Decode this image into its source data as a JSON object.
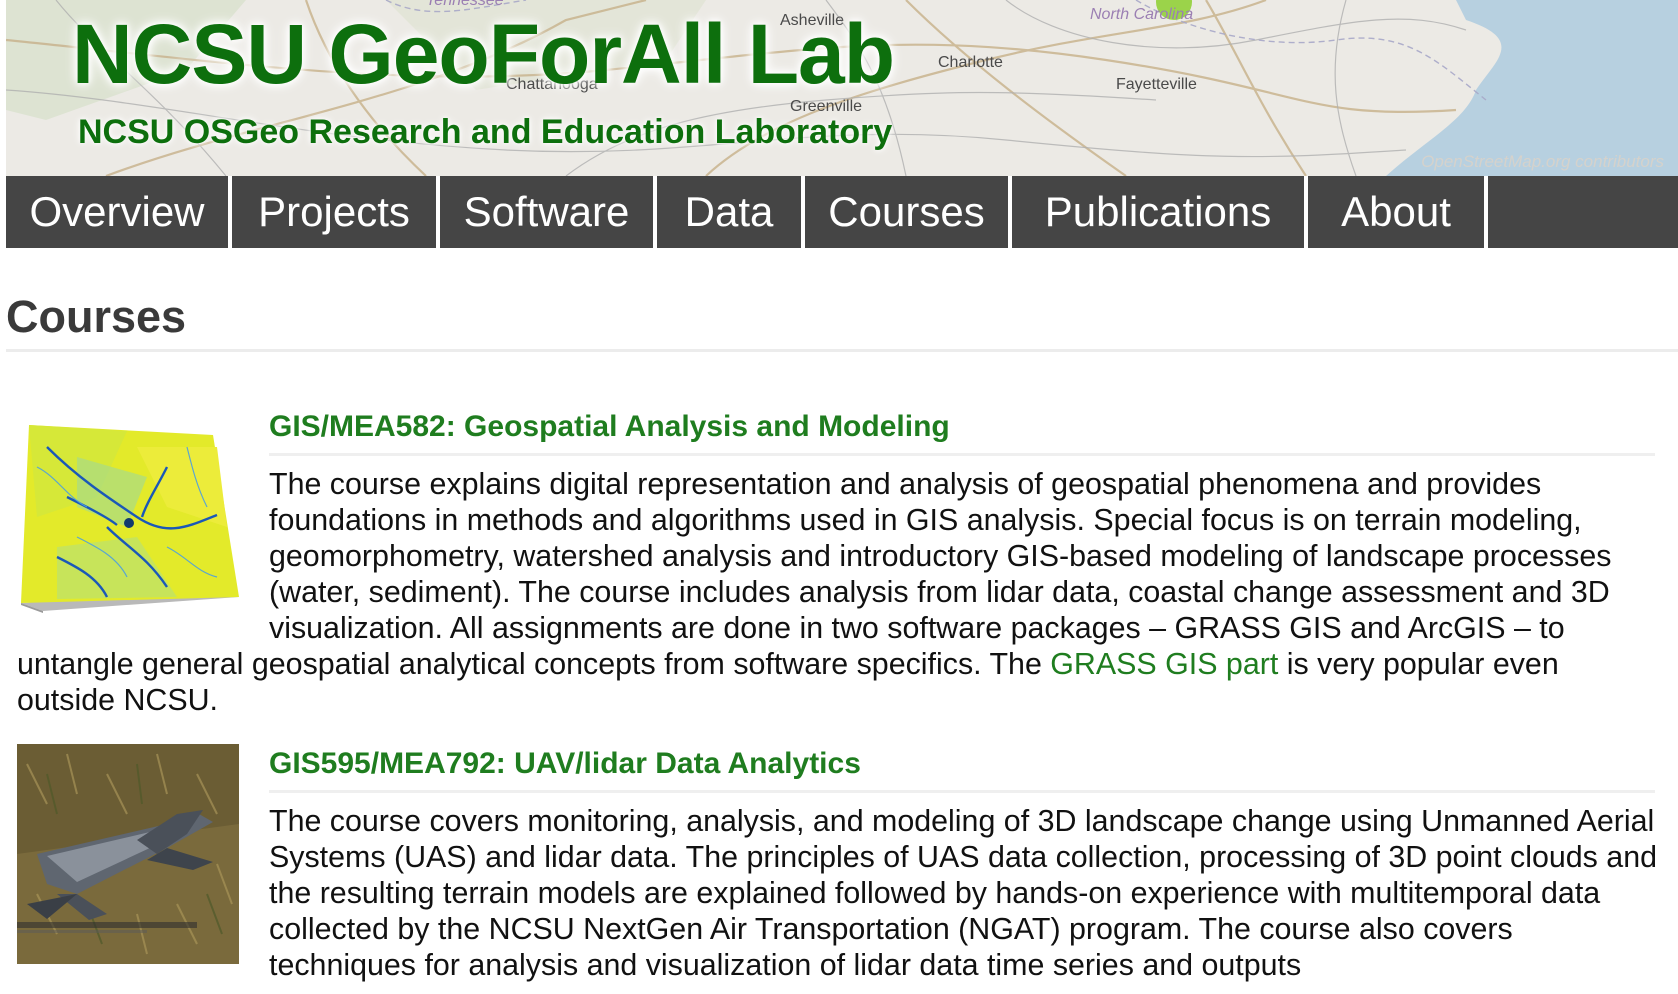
{
  "site": {
    "title": "NCSU GeoForAll Lab",
    "subtitle": "NCSU OSGeo Research and Education Laboratory",
    "map_labels": {
      "tennessee": "Tennessee",
      "asheville": "Asheville",
      "north_carolina": "North Carolina",
      "charlotte": "Charlotte",
      "fayetteville": "Fayetteville",
      "chattanooga": "Chattanooga",
      "greenville": "Greenville"
    },
    "map_credit": "OpenStreetMap.org contributors"
  },
  "nav": {
    "items": [
      {
        "label": "Overview"
      },
      {
        "label": "Projects"
      },
      {
        "label": "Software"
      },
      {
        "label": "Data"
      },
      {
        "label": "Courses"
      },
      {
        "label": "Publications"
      },
      {
        "label": "About"
      },
      {
        "label": ""
      }
    ]
  },
  "page": {
    "title": "Courses"
  },
  "courses": [
    {
      "title": "GIS/MEA582: Geospatial Analysis and Modeling",
      "description_before": "The course explains digital representation and analysis of geospatial phenomena and provides foundations in methods and algorithms used in GIS analysis. Special focus is on terrain modeling, geomorphometry, watershed analysis and introductory GIS-based modeling of landscape processes (water, sediment). The course includes analysis from lidar data, coastal change assessment and 3D visualization. All assignments are done in two software packages – GRASS GIS and ArcGIS – to untangle general geospatial analytical concepts from software specifics. The ",
      "link_text": "GRASS GIS part",
      "description_after": " is very popular even outside NCSU.",
      "thumbnail": "terrain-model-image"
    },
    {
      "title": "GIS595/MEA792: UAV/lidar Data Analytics",
      "description": "The course covers monitoring, analysis, and modeling of 3D landscape change using Unmanned Aerial Systems (UAS) and lidar data. The principles of UAS data collection, processing of 3D point clouds and the resulting terrain models are explained followed by hands-on experience with multitemporal data collected by the NCSU NextGen Air Transportation (NGAT) program. The course also covers techniques for analysis and visualization of lidar data time series and outputs",
      "thumbnail": "uav-drone-image"
    }
  ],
  "colors": {
    "brand_green": "#0d6f0d",
    "link_green": "#1f7d1f",
    "nav_bg": "#454545",
    "nav_text": "#ffffff"
  }
}
